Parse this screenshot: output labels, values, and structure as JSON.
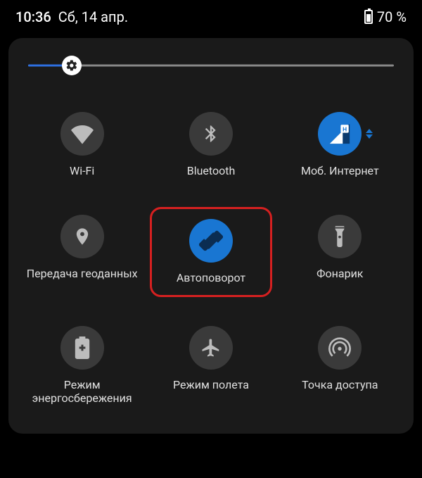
{
  "status": {
    "time": "10:36",
    "date": "Сб, 14 апр.",
    "battery_percent": "70 %"
  },
  "brightness": {
    "value_percent": 12
  },
  "tiles": [
    {
      "id": "wifi",
      "label": "Wi-Fi",
      "active": false
    },
    {
      "id": "bluetooth",
      "label": "Bluetooth",
      "active": false
    },
    {
      "id": "mobile-data",
      "label": "Моб. Интернет",
      "active": true
    },
    {
      "id": "location",
      "label": "Передача геоданных",
      "active": false
    },
    {
      "id": "auto-rotate",
      "label": "Автоповорот",
      "active": true,
      "highlighted": true
    },
    {
      "id": "flashlight",
      "label": "Фонарик",
      "active": false
    },
    {
      "id": "battery-saver",
      "label": "Режим энергосбережения",
      "active": false
    },
    {
      "id": "airplane",
      "label": "Режим полета",
      "active": false
    },
    {
      "id": "hotspot",
      "label": "Точка доступа",
      "active": false
    }
  ],
  "colors": {
    "accent": "#1976d2",
    "highlight_border": "#d62020",
    "tile_inactive": "#3a3a3a",
    "panel_bg": "#1a1a1a"
  }
}
